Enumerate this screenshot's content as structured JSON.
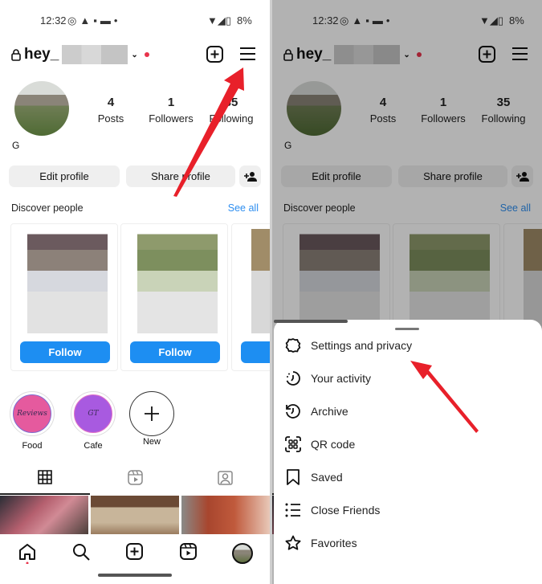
{
  "status_bar": {
    "time": "12:32",
    "battery": "8%"
  },
  "profile": {
    "username_prefix": "hey_",
    "stats": [
      {
        "value": "4",
        "label": "Posts"
      },
      {
        "value": "1",
        "label": "Followers"
      },
      {
        "value": "35",
        "label": "Following"
      }
    ],
    "name": "G",
    "edit_profile": "Edit profile",
    "share_profile": "Share profile"
  },
  "discover": {
    "title": "Discover people",
    "see_all": "See all",
    "follow_label": "Follow"
  },
  "highlights": [
    {
      "label": "Food",
      "cover_text": "Reviews"
    },
    {
      "label": "Cafe",
      "cover_text": "GT"
    },
    {
      "label": "New"
    }
  ],
  "menu": {
    "items": [
      {
        "label": "Settings and privacy",
        "icon": "gear-icon"
      },
      {
        "label": "Your activity",
        "icon": "activity-icon"
      },
      {
        "label": "Archive",
        "icon": "archive-icon"
      },
      {
        "label": "QR code",
        "icon": "qr-code-icon"
      },
      {
        "label": "Saved",
        "icon": "bookmark-icon"
      },
      {
        "label": "Close Friends",
        "icon": "close-friends-icon"
      },
      {
        "label": "Favorites",
        "icon": "star-icon"
      }
    ]
  },
  "colors": {
    "accent": "#1d8ef2",
    "arrow": "#e8202a",
    "notification": "#e8334b"
  }
}
